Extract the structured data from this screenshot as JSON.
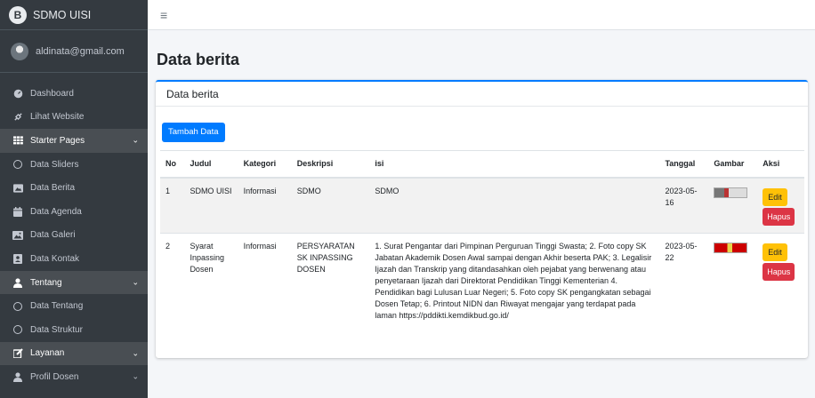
{
  "brand": {
    "name": "SDMO UISI",
    "logo_letter": "B"
  },
  "user": {
    "email": "aldinata@gmail.com"
  },
  "sidebar": {
    "items": [
      {
        "label": "Dashboard",
        "icon": "tachometer-icon"
      },
      {
        "label": "Lihat Website",
        "icon": "link-icon"
      },
      {
        "label": "Starter Pages",
        "icon": "grid-icon",
        "active": true,
        "expandable": true
      },
      {
        "label": "Data Sliders",
        "icon": "circle-icon"
      },
      {
        "label": "Data Berita",
        "icon": "image-icon"
      },
      {
        "label": "Data Agenda",
        "icon": "calendar-icon"
      },
      {
        "label": "Data Galeri",
        "icon": "gallery-icon"
      },
      {
        "label": "Data Kontak",
        "icon": "contact-icon"
      },
      {
        "label": "Tentang",
        "icon": "user-icon",
        "active": true,
        "expandable": true
      },
      {
        "label": "Data Tentang",
        "icon": "circle-icon"
      },
      {
        "label": "Data Struktur",
        "icon": "circle-icon"
      },
      {
        "label": "Layanan",
        "icon": "edit-icon",
        "active": true,
        "expandable": true
      },
      {
        "label": "Profil Dosen",
        "icon": "user-icon",
        "expandable": true
      }
    ]
  },
  "page": {
    "title": "Data berita"
  },
  "card": {
    "title": "Data berita",
    "add_button": "Tambah Data",
    "columns": [
      "No",
      "Judul",
      "Kategori",
      "Deskripsi",
      "isi",
      "Tanggal",
      "Gambar",
      "Aksi"
    ],
    "rows": [
      {
        "no": "1",
        "judul": "SDMO UISI",
        "kategori": "Informasi",
        "deskripsi": "SDMO",
        "isi": "SDMO",
        "tanggal": "2023-05-16"
      },
      {
        "no": "2",
        "judul": "Syarat Inpassing Dosen",
        "kategori": "Informasi",
        "deskripsi": "PERSYARATAN SK INPASSING DOSEN",
        "isi": "1. Surat Pengantar dari Pimpinan Perguruan Tinggi Swasta; 2. Foto copy SK Jabatan Akademik Dosen Awal sampai dengan Akhir beserta PAK; 3. Legalisir Ijazah dan Transkrip yang ditandasahkan oleh pejabat yang berwenang atau penyetaraan Ijazah dari Direktorat Pendidikan Tinggi Kementerian 4. Pendidikan bagi Lulusan Luar Negeri; 5. Foto copy SK pengangkatan sebagai Dosen Tetap; 6. Printout NIDN dan Riwayat mengajar yang terdapat pada laman https://pddikti.kemdikbud.go.id/",
        "tanggal": "2023-05-22"
      }
    ],
    "edit_label": "Edit",
    "delete_label": "Hapus"
  }
}
